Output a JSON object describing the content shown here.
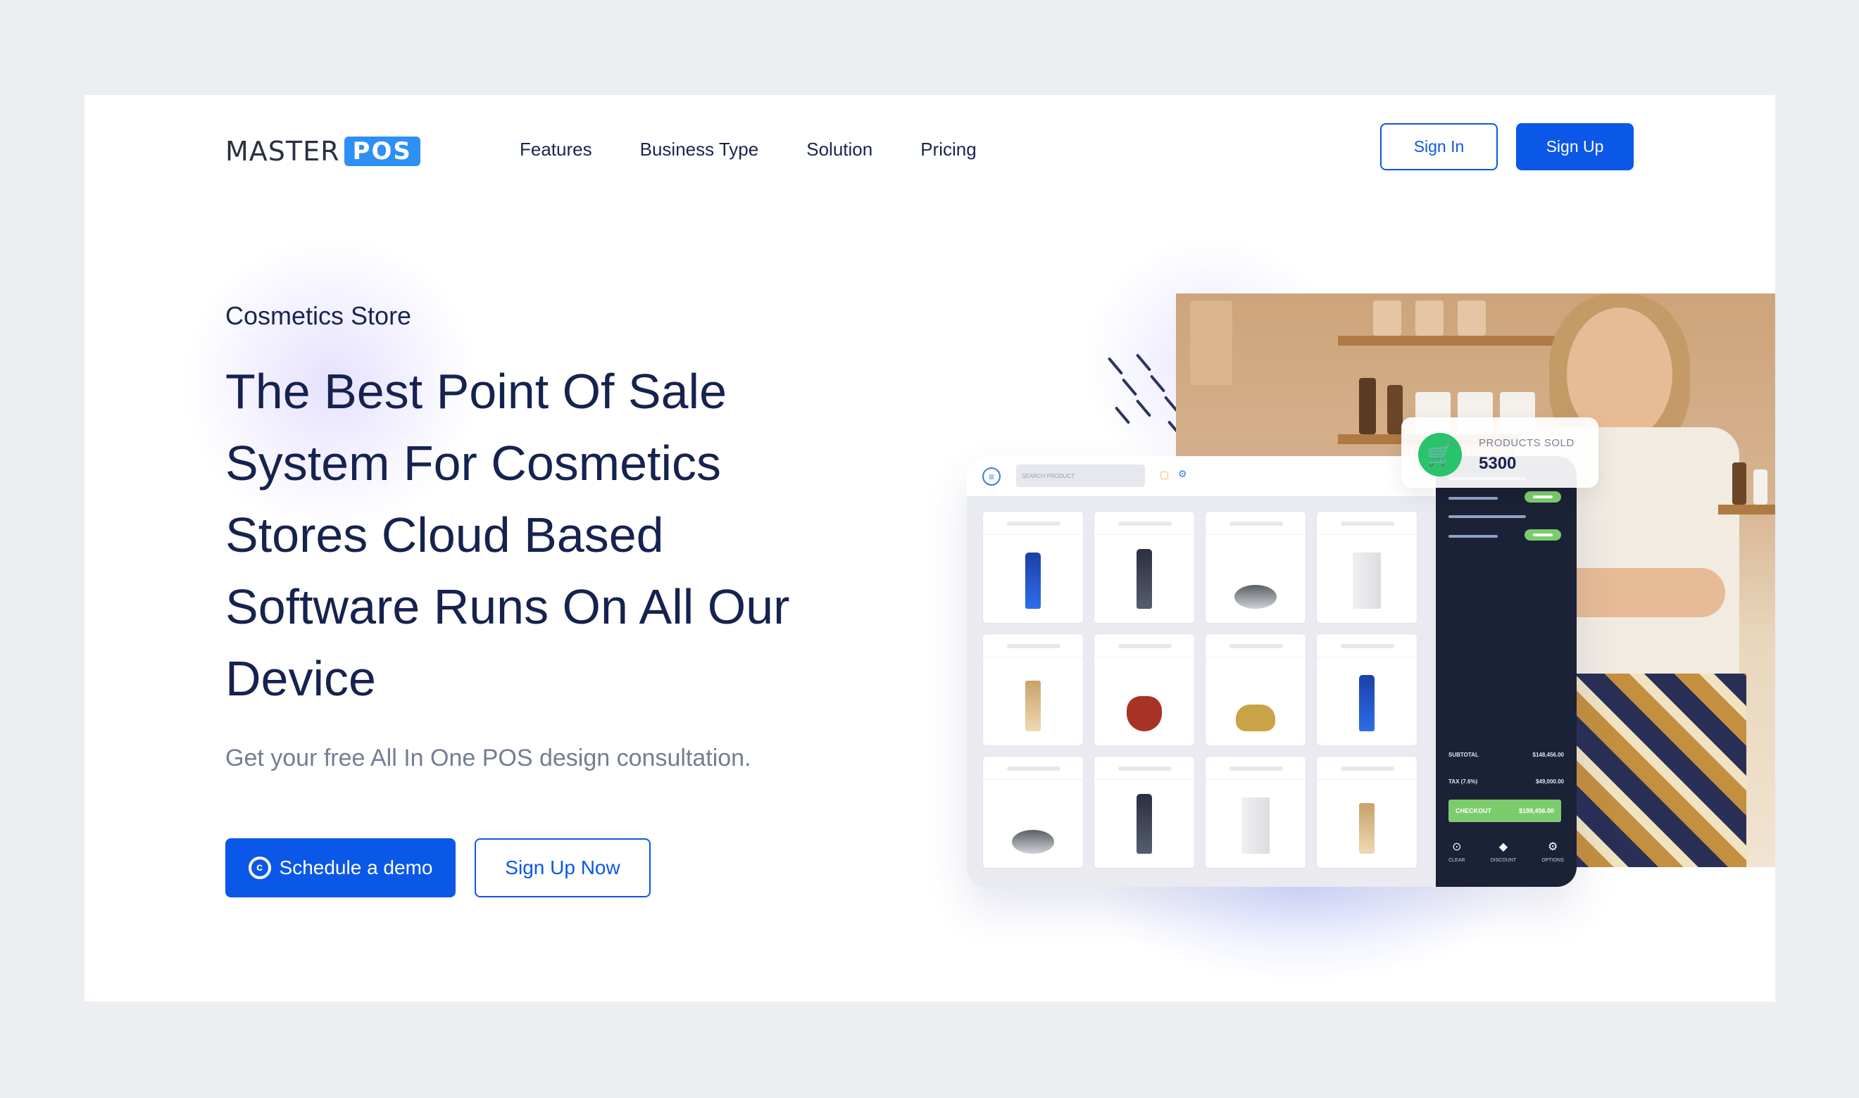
{
  "brand": {
    "logo_text": "MASTER",
    "logo_badge": "POS"
  },
  "nav": {
    "items": [
      "Features",
      "Business Type",
      "Solution",
      "Pricing"
    ]
  },
  "header": {
    "signin_label": "Sign In",
    "signup_label": "Sign Up"
  },
  "hero": {
    "eyebrow": "Cosmetics Store",
    "headline": "The Best Point Of Sale System For Cosmetics Stores Cloud Based Software Runs On All Our Device",
    "subtext": "Get your free All In One POS design consultation.",
    "demo_label": "Schedule a demo",
    "signup_now_label": "Sign Up Now"
  },
  "stat_card": {
    "label": "PRODUCTS SOLD",
    "value": "5300"
  },
  "pos": {
    "search_placeholder": "SEARCH PRODUCT",
    "subtotal_label": "SUBTOTAL",
    "subtotal_value": "$148,456.00",
    "tax_label": "TAX (7.6%)",
    "tax_value": "$49,000.00",
    "checkout_label": "CHECKOUT",
    "checkout_value": "$198,456.00",
    "actions": [
      "CLEAR",
      "DISCOUNT",
      "OPTIONS"
    ]
  },
  "colors": {
    "accent": "#0b57e8",
    "text_dark": "#16224f",
    "pos_sidebar": "#1b2236",
    "success": "#7ccc6d"
  }
}
